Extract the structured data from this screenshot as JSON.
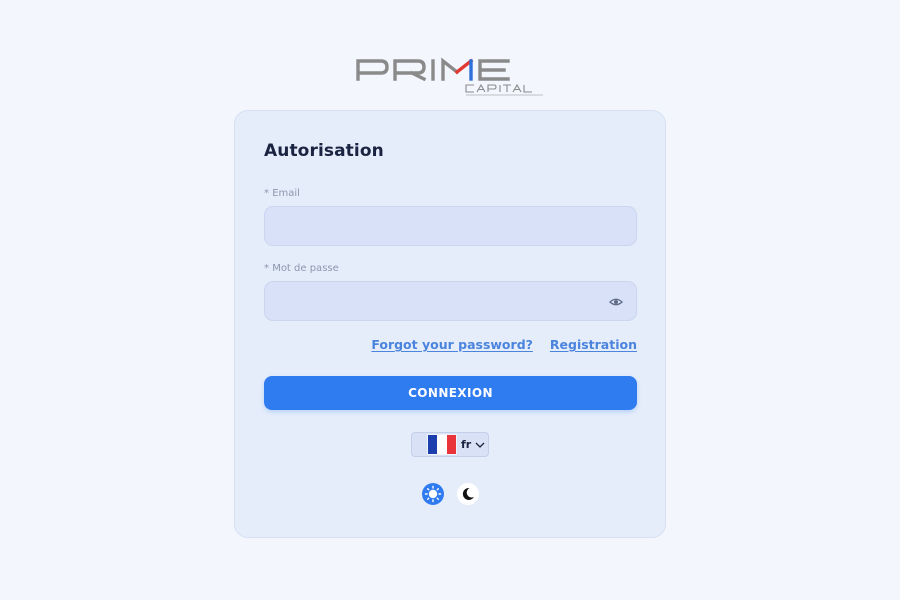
{
  "brand": {
    "name_main": "PRIME",
    "name_sub": "CAPITAL"
  },
  "form": {
    "title": "Autorisation",
    "email_label": "Email",
    "email_required_mark": "* ",
    "email_value": "",
    "password_label": "Mot de passe",
    "password_required_mark": "* ",
    "password_value": "",
    "forgot_link": "Forgot your password?",
    "registration_link": "Registration",
    "submit_label": "CONNEXION"
  },
  "language": {
    "selected": "fr",
    "flag_colors": [
      "#1d3fae",
      "#ffffff",
      "#e9343b"
    ]
  },
  "theme": {
    "options": [
      "light",
      "dark"
    ],
    "active": "light"
  },
  "colors": {
    "accent": "#2f7bf0",
    "link": "#4b84dd",
    "logo_gray": "#8a8a8a",
    "logo_red": "#e13a32",
    "logo_blue": "#2f6fd8"
  }
}
